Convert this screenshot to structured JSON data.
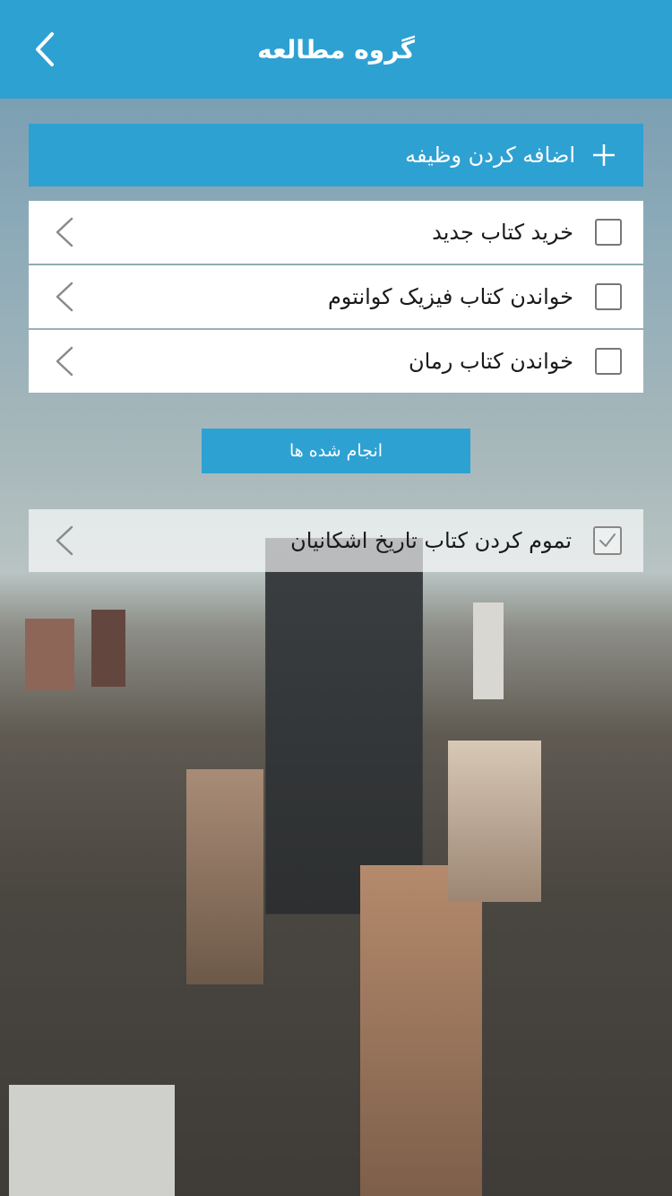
{
  "header": {
    "title": "گروه مطالعه",
    "back_icon": "chevron-left-icon"
  },
  "add_task": {
    "label": "اضافه کردن وظیفه",
    "icon": "plus-icon"
  },
  "tasks": [
    {
      "label": "خرید کتاب جدید",
      "checked": false
    },
    {
      "label": "خواندن کتاب فیزیک کوانتوم",
      "checked": false
    },
    {
      "label": "خواندن کتاب رمان",
      "checked": false
    }
  ],
  "done_section": {
    "button_label": "انجام شده ها"
  },
  "completed_tasks": [
    {
      "label": "تموم کردن کتاب تاریخ اشکانیان",
      "checked": true
    }
  ],
  "colors": {
    "primary": "#2ea1d3",
    "white": "#ffffff",
    "text": "#1a1a1a"
  }
}
